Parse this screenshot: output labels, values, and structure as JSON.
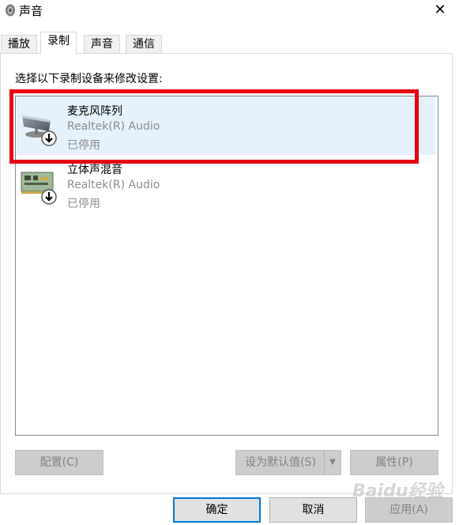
{
  "window": {
    "title": "声音",
    "close_symbol": "✕"
  },
  "tabs": [
    {
      "label": "播放",
      "active": false
    },
    {
      "label": "录制",
      "active": true
    },
    {
      "label": "声音",
      "active": false
    },
    {
      "label": "通信",
      "active": false
    }
  ],
  "instruction": "选择以下录制设备来修改设置:",
  "devices": [
    {
      "name": "麦克风阵列",
      "driver": "Realtek(R) Audio",
      "status": "已停用",
      "icon": "microphone-array-icon",
      "selected": true
    },
    {
      "name": "立体声混音",
      "driver": "Realtek(R) Audio",
      "status": "已停用",
      "icon": "sound-card-icon",
      "selected": false
    }
  ],
  "buttons": {
    "configure": "配置(C)",
    "set_default": "设为默认值(S)",
    "properties": "属性(P)",
    "ok": "确定",
    "cancel": "取消",
    "apply": "应用(A)"
  },
  "watermark": "Baidu经验",
  "colors": {
    "highlight": "#e60012",
    "selection": "#e5f1fb",
    "primary_border": "#0078d7"
  }
}
